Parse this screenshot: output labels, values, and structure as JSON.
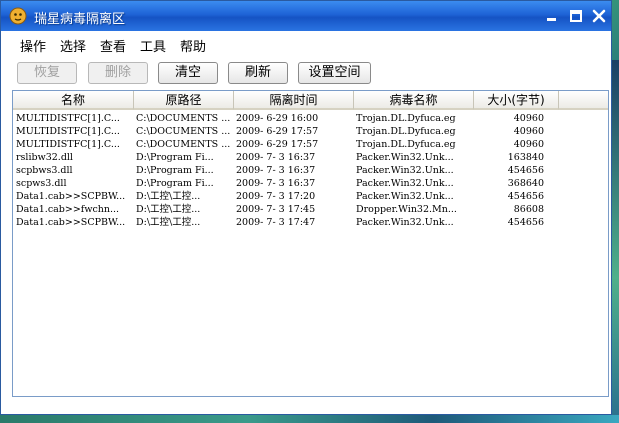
{
  "window": {
    "title": "瑞星病毒隔离区"
  },
  "menu": [
    "操作",
    "选择",
    "查看",
    "工具",
    "帮助"
  ],
  "toolbar": {
    "restore_label": "恢复",
    "delete_label": "删除",
    "clear_label": "清空",
    "refresh_label": "刷新",
    "settings_label": "设置空间"
  },
  "table": {
    "columns": [
      "名称",
      "原路径",
      "隔离时间",
      "病毒名称",
      "大小(字节)"
    ],
    "rows": [
      [
        "MULTIDISTFC[1].C...",
        "C:\\DOCUMENTS ...",
        "2009- 6-29 16:00",
        "Trojan.DL.Dyfuca.eg",
        "40960"
      ],
      [
        "MULTIDISTFC[1].C...",
        "C:\\DOCUMENTS ...",
        "2009- 6-29 17:57",
        "Trojan.DL.Dyfuca.eg",
        "40960"
      ],
      [
        "MULTIDISTFC[1].C...",
        "C:\\DOCUMENTS ...",
        "2009- 6-29 17:57",
        "Trojan.DL.Dyfuca.eg",
        "40960"
      ],
      [
        "rslibw32.dll",
        "D:\\Program Fi...",
        "2009- 7- 3 16:37",
        "Packer.Win32.Unk...",
        "163840"
      ],
      [
        "scpbws3.dll",
        "D:\\Program Fi...",
        "2009- 7- 3 16:37",
        "Packer.Win32.Unk...",
        "454656"
      ],
      [
        "scpws3.dll",
        "D:\\Program Fi...",
        "2009- 7- 3 16:37",
        "Packer.Win32.Unk...",
        "368640"
      ],
      [
        "Data1.cab>>SCPBW...",
        "D:\\工控\\工控...",
        "2009- 7- 3 17:20",
        "Packer.Win32.Unk...",
        "454656"
      ],
      [
        "Data1.cab>>fwchn...",
        "D:\\工控\\工控...",
        "2009- 7- 3 17:45",
        "Dropper.Win32.Mn...",
        "86608"
      ],
      [
        "Data1.cab>>SCPBW...",
        "D:\\工控\\工控...",
        "2009- 7- 3 17:47",
        "Packer.Win32.Unk...",
        "454656"
      ]
    ]
  },
  "colors": {
    "titlebar": "#1e63d6",
    "list_border": "#7a9cc8"
  }
}
